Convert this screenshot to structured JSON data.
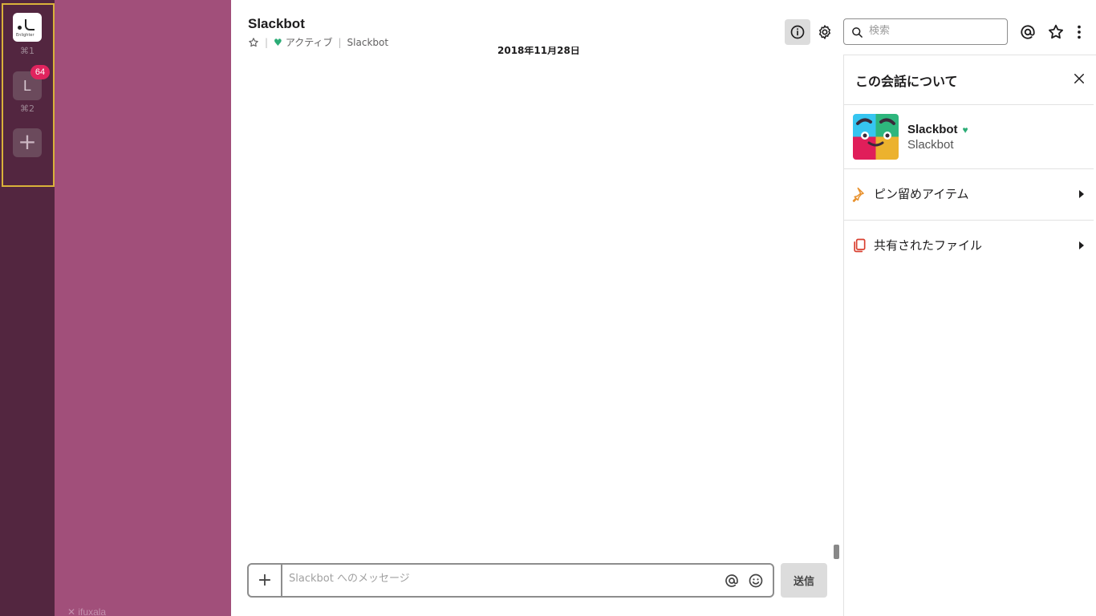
{
  "workspaces": [
    {
      "name": "ws-1",
      "shortcut": "⌘1",
      "logo_text": "Enlighter"
    },
    {
      "name": "ws-2",
      "initial": "L",
      "badge": "64",
      "shortcut": "⌘2"
    }
  ],
  "add_workspace_label": "+",
  "sidebar": {
    "footer_text": "✕ ifuxala"
  },
  "channel": {
    "title": "Slackbot",
    "status": "アクティブ",
    "subtitle": "Slackbot",
    "date_divider": "2018年11月28日"
  },
  "composer": {
    "placeholder": "Slackbot へのメッセージ",
    "value": "",
    "plus_label": "+",
    "send_label": "送信"
  },
  "header": {
    "search_placeholder": "検索"
  },
  "details": {
    "title": "この会話について",
    "bot_name": "Slackbot",
    "bot_subtitle": "Slackbot",
    "sections": [
      {
        "label": "ピン留めアイテム",
        "icon": "pin-icon"
      },
      {
        "label": "共有されたファイル",
        "icon": "file-icon"
      }
    ]
  },
  "colors": {
    "rail": "#532640",
    "sidebar": "#a14f7a",
    "badge": "#e0245e",
    "presence": "#2bac76"
  }
}
